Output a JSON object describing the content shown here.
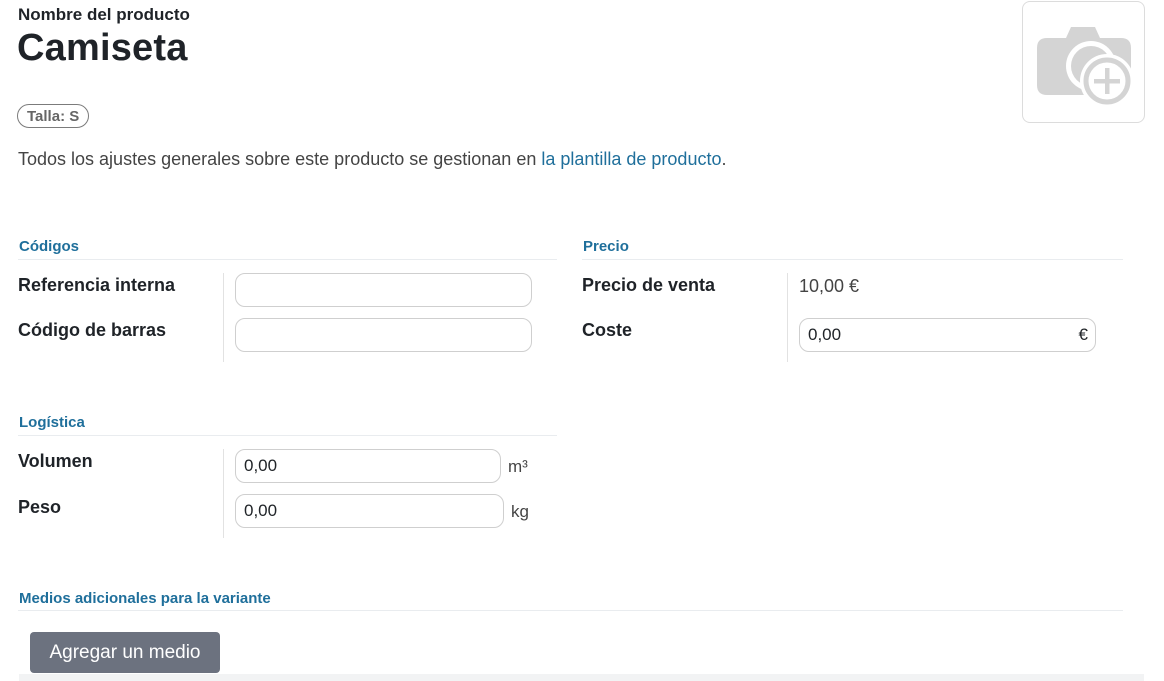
{
  "header": {
    "label": "Nombre del producto",
    "title": "Camiseta",
    "badge": "Talla: S",
    "note_prefix": "Todos los ajustes generales sobre este producto se gestionan en ",
    "note_link": "la plantilla de producto",
    "note_suffix": "."
  },
  "image": {
    "icon": "camera-plus-icon"
  },
  "sections": {
    "codigos": {
      "title": "Códigos",
      "internal_ref_label": "Referencia interna",
      "internal_ref_value": "",
      "barcode_label": "Código de barras",
      "barcode_value": ""
    },
    "precio": {
      "title": "Precio",
      "sale_label": "Precio de venta",
      "sale_value": "10,00 €",
      "cost_label": "Coste",
      "cost_value": "0,00",
      "cost_currency": "€"
    },
    "logistica": {
      "title": "Logística",
      "volume_label": "Volumen",
      "volume_value": "0,00",
      "volume_unit": "m³",
      "weight_label": "Peso",
      "weight_value": "0,00",
      "weight_unit": "kg"
    },
    "media": {
      "title": "Medios adicionales para la variante",
      "add_button": "Agregar un medio"
    }
  }
}
